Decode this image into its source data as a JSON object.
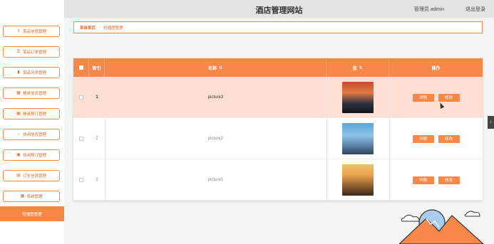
{
  "header": {
    "title": "酒店管理网站",
    "user_label": "管理员 admin",
    "logout_label": "退出登录"
  },
  "sidebar": {
    "items": [
      {
        "label": "菜品信息管理",
        "icon": "sliders-icon"
      },
      {
        "label": "菜品订单管理",
        "icon": "list-icon"
      },
      {
        "label": "菜品分类管理",
        "icon": "bar-chart-icon"
      },
      {
        "label": "餐桌信息管理",
        "icon": "grid-icon"
      },
      {
        "label": "餐桌预订管理",
        "icon": "grid-icon"
      },
      {
        "label": "休闲信息管理",
        "icon": "house-icon"
      },
      {
        "label": "休闲预订管理",
        "icon": "briefcase-icon"
      },
      {
        "label": "订车信息管理",
        "icon": "bus-icon"
      },
      {
        "label": "系统管理",
        "icon": "grid-icon"
      },
      {
        "label": "轮播图管理",
        "icon": ""
      }
    ]
  },
  "breadcrumb": {
    "home": "系统首页",
    "separator": "::",
    "current": "轮播图管理"
  },
  "table": {
    "headers": {
      "index": "索引",
      "name": "名称",
      "value": "值",
      "action": "操作",
      "sort_icon": "⇅"
    },
    "rows": [
      {
        "index": "1",
        "name": "picture3",
        "thumb": "city-sunset"
      },
      {
        "index": "2",
        "name": "picture2",
        "thumb": "city-day"
      },
      {
        "index": "3",
        "name": "picture1",
        "thumb": "city-golden"
      }
    ],
    "detail_label": "详情",
    "edit_label": "修改"
  },
  "ui": {
    "collapse_glyph": "‹"
  },
  "colors": {
    "accent": "#f7884a",
    "highlight_row": "#fde0d2",
    "header_bg": "#e3e3e3"
  }
}
